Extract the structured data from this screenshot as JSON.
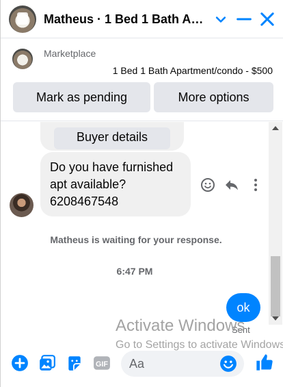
{
  "header": {
    "title": "Matheus · 1 Bed 1 Bath Ap...",
    "minimize_icon": "chevron-down-icon",
    "close_icon": "close-icon",
    "collapse_icon": "minimize-icon"
  },
  "marketplace": {
    "label": "Marketplace",
    "listing": "1 Bed 1 Bath Apartment/condo - $500",
    "buttons": [
      "Mark as pending",
      "More options"
    ]
  },
  "messages": {
    "buyer_details_label": "Buyer details",
    "incoming": [
      "Do you have furnished",
      "apt available?",
      "6208467548"
    ],
    "actions": [
      "emoji-reaction-icon",
      "reply-icon",
      "more-icon"
    ],
    "waiting_text": "Matheus is waiting for your response.",
    "timestamp": "6:47 PM",
    "outgoing": "ok",
    "status": "Sent"
  },
  "watermark": {
    "title": "Activate Windows",
    "subtitle": "Go to Settings to activate Windows."
  },
  "composer": {
    "placeholder": "Aa",
    "icons": [
      "plus-icon",
      "photo-icon",
      "sticker-icon",
      "gif-icon",
      "emoji-icon",
      "like-icon"
    ]
  },
  "colors": {
    "accent": "#0084ff",
    "bubble_incoming": "#f0f0f0",
    "secondary_text": "#65676b"
  }
}
